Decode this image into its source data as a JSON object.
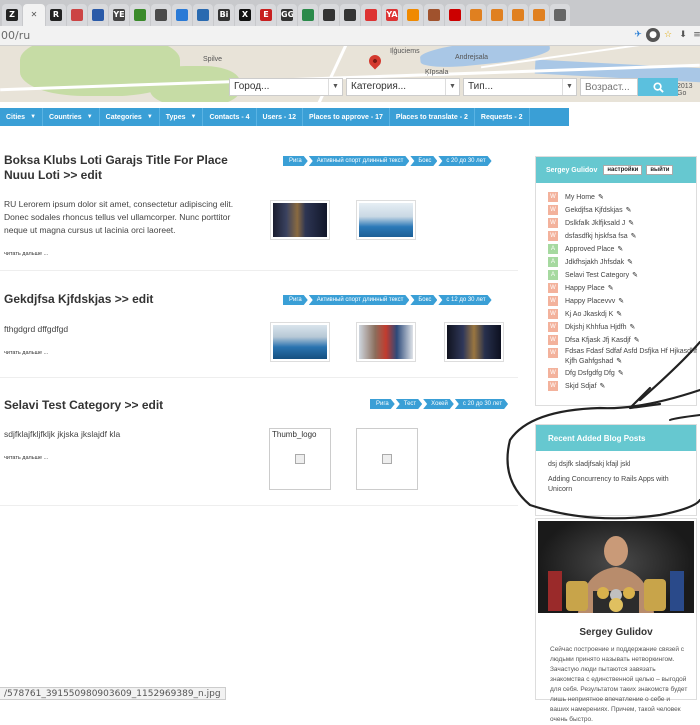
{
  "browser": {
    "url": "00/ru",
    "tab_icons": [
      "z-icon",
      "r-icon",
      "u-icon",
      "globe-icon",
      "ye-icon",
      "gear-icon",
      "refresh-icon",
      "yin-icon",
      "info-icon",
      "bi-icon",
      "x-icon",
      "e-icon",
      "link-icon",
      "gmail-icon",
      "chrome-icon",
      "github-icon",
      "share-icon",
      "ya-icon",
      "ya-icon",
      "plus-icon",
      "cpu-icon",
      "cpu-icon",
      "dev-icon",
      "dev-icon",
      "dev-icon",
      "dev-icon",
      "grid-icon"
    ],
    "tab_letters": [
      "Z",
      "",
      "R",
      "",
      "",
      "YE",
      "",
      "",
      "",
      "",
      "Bi",
      "X",
      "E",
      "GG",
      "",
      "",
      "",
      "",
      "YA",
      "",
      "",
      "",
      "",
      "",
      "",
      "",
      ""
    ],
    "status_url": "/578761_391550980903609_1152969389_n.jpg"
  },
  "map": {
    "labels": [
      "Spilve",
      "Andrejsala",
      "Ķīpsala",
      "Iļģuciems",
      "2013 Go"
    ],
    "city_placeholder": "Город...",
    "category_placeholder": "Категория...",
    "type_placeholder": "Тип...",
    "age_placeholder": "Возраст..."
  },
  "nav": [
    {
      "label": "Cities",
      "dropdown": true
    },
    {
      "label": "Countries",
      "dropdown": true
    },
    {
      "label": "Categories",
      "dropdown": true
    },
    {
      "label": "Types",
      "dropdown": true
    },
    {
      "label": "Contacts - 4",
      "dropdown": false
    },
    {
      "label": "Users - 12",
      "dropdown": false
    },
    {
      "label": "Places to approve - 17",
      "dropdown": false
    },
    {
      "label": "Places to translate - 2",
      "dropdown": false
    },
    {
      "label": "Requests - 2",
      "dropdown": false
    }
  ],
  "posts": [
    {
      "title": "Boksa Klubs Loti Garajs Title For Place Nuuu Loti >> edit",
      "crumbs": [
        "Рига",
        "Активный спорт длинный текст",
        "Бокс",
        "с 20 до 30 лет"
      ],
      "text": "RU Lerorem ipsum dolor sit amet, consectetur adipiscing elit. Donec sodales rhoncus tellus vel ullamcorper. Nunc porttitor neque ut magna cursus ut lacinia orci laoreet.",
      "read_more": "читать дальше ..."
    },
    {
      "title": "Gekdjfsa Kjfdskjas >> edit",
      "crumbs": [
        "Рига",
        "Активный спорт длинный текст",
        "Бокс",
        "с 12 до 30 лет"
      ],
      "text": "fthgdgrd dffgdfgd",
      "read_more": "читать дальше ..."
    },
    {
      "title": "Selavi Test Category >> edit",
      "crumbs": [
        "Рига",
        "Тест",
        "Хокей",
        "с 20 до 30 лет"
      ],
      "text": "sdjfklajfkljfkljk jkjska jkslajdf kla",
      "read_more": "читать дальше ...",
      "thumb_caption": "Thumb_logo"
    }
  ],
  "sidebar": {
    "user_name": "Sergey Gulidov",
    "settings_btn": "настройки",
    "logout_btn": "выйти",
    "items": [
      {
        "badge": "W",
        "label": "My Home"
      },
      {
        "badge": "W",
        "label": "Gekdjfsa Kjfdskjas"
      },
      {
        "badge": "W",
        "label": "Dslkfalk Jklfjksald J"
      },
      {
        "badge": "W",
        "label": "dsfasdfkj hjskfsa fsa"
      },
      {
        "badge": "A",
        "label": "Approved Place"
      },
      {
        "badge": "A",
        "label": "Jdkfhsjakh Jhfsdak"
      },
      {
        "badge": "A",
        "label": "Selavi Test Category"
      },
      {
        "badge": "W",
        "label": "Happy Place"
      },
      {
        "badge": "W",
        "label": "Happy Placevvv"
      },
      {
        "badge": "W",
        "label": "Kj Ao Jkaskdj K"
      },
      {
        "badge": "W",
        "label": "Dkjshj Khhfua Hjdfh"
      },
      {
        "badge": "W",
        "label": "Dfsa Kfjask Jfj Kasdjf"
      },
      {
        "badge": "W",
        "label": "Fdsas Fdasf Sdfaf Asfd Dsfjka Hf Hjkasdhf Kjfh Gahfgshad"
      },
      {
        "badge": "W",
        "label": "Dfg Dsfgdfg Dfg"
      },
      {
        "badge": "W",
        "label": "Skjd Sdjaf"
      }
    ],
    "blog_title": "Recent Added Blog Posts",
    "blog_posts": [
      "dsj dsjfk sladjfsakj kfajl jskl",
      "Adding Concurrency to Rails Apps with Unicorn"
    ],
    "profile_name": "Sergey Gulidov",
    "profile_bio": "Сейчас построение и поддержание связей с людьми принято называть нетворкингом. Зачастую люди пытаются завязать знакомства с единственной целью – выгодой для себя. Результатом таких знакомств будет лишь неприятное впечатление о себе и ваших намерениях. Причем, такой человек очень быстро."
  },
  "colors": {
    "nav_blue": "#3a9fd6",
    "sidebar_teal": "#66c8d0",
    "badge_w": "#f3b29c",
    "badge_a": "#a6d9a0"
  }
}
